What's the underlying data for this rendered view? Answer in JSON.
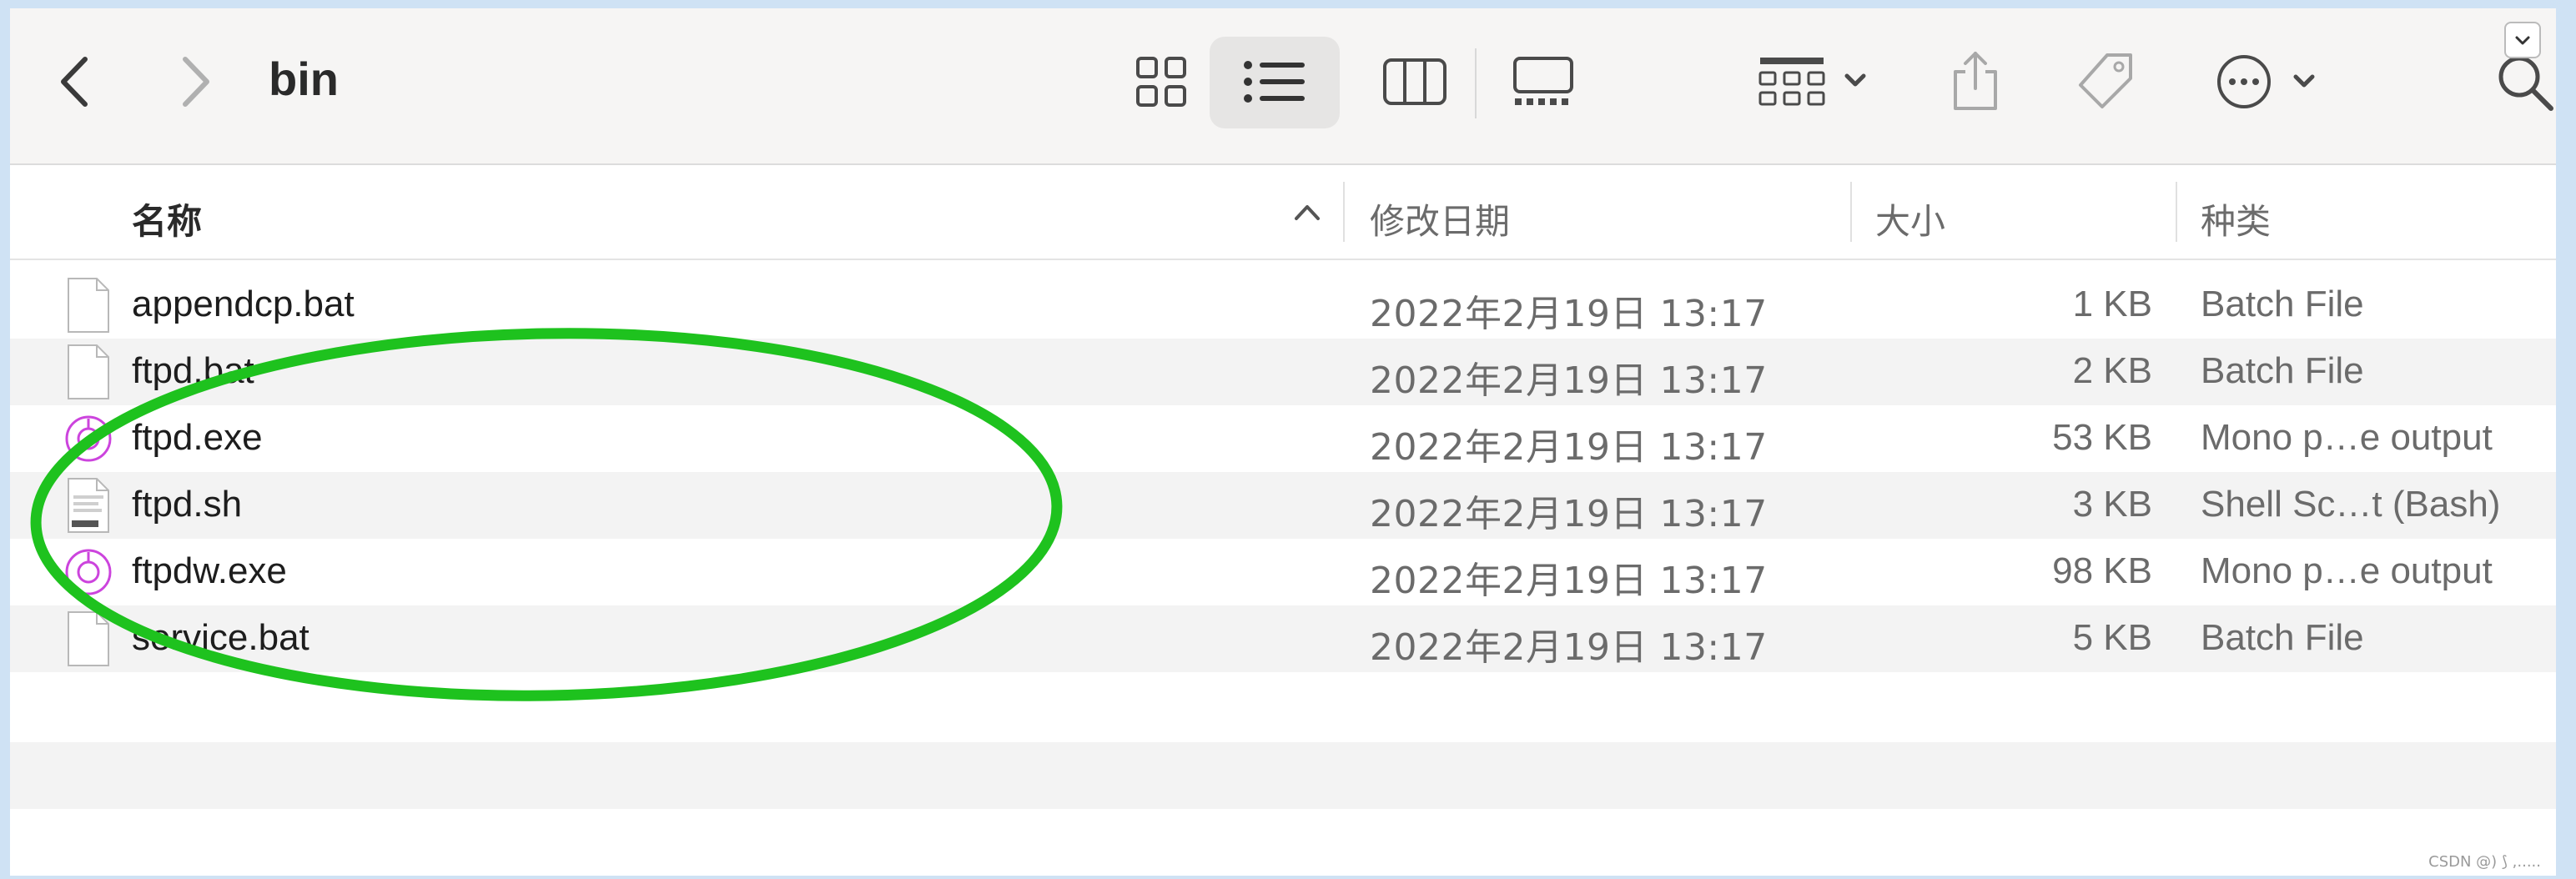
{
  "toolbar": {
    "title": "bin",
    "icons": [
      "chevron-left-icon",
      "chevron-right-icon",
      "grid-view-icon",
      "list-view-icon",
      "column-view-icon",
      "gallery-view-icon",
      "group-icon",
      "share-icon",
      "tag-icon",
      "more-icon",
      "search-icon"
    ]
  },
  "columns": {
    "name": "名称",
    "date": "修改日期",
    "size": "大小",
    "kind": "种类"
  },
  "files": [
    {
      "name": "appendcp.bat",
      "date": "2022年2月19日 13:17",
      "size": "1 KB",
      "kind": "Batch File",
      "icon": "document-icon"
    },
    {
      "name": "ftpd.bat",
      "date": "2022年2月19日 13:17",
      "size": "2 KB",
      "kind": "Batch File",
      "icon": "document-icon"
    },
    {
      "name": "ftpd.exe",
      "date": "2022年2月19日 13:17",
      "size": "53 KB",
      "kind": "Mono p…e output",
      "icon": "mono-exe-icon"
    },
    {
      "name": "ftpd.sh",
      "date": "2022年2月19日 13:17",
      "size": "3 KB",
      "kind": "Shell Sc…t (Bash)",
      "icon": "shell-script-icon"
    },
    {
      "name": "ftpdw.exe",
      "date": "2022年2月19日 13:17",
      "size": "98 KB",
      "kind": "Mono p…e output",
      "icon": "mono-exe-icon"
    },
    {
      "name": "service.bat",
      "date": "2022年2月19日 13:17",
      "size": "5 KB",
      "kind": "Batch File",
      "icon": "document-icon"
    }
  ],
  "watermark": "CSDN @) ⟆ ,.....",
  "colors": {
    "annotation": "#1ec21e",
    "stripe": "#f3f3f3",
    "toolbar_bg": "#f6f5f4",
    "mono_icon": "#cc44dd"
  }
}
